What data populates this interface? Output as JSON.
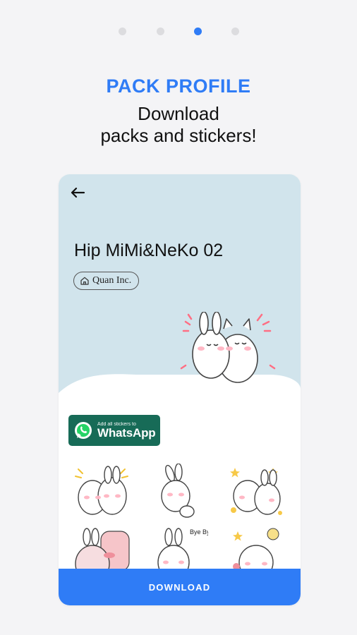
{
  "onboarding": {
    "pages": 4,
    "active_page": 3,
    "headline": "PACK PROFILE",
    "subline_1": "Download",
    "subline_2": "packs and stickers!"
  },
  "pack": {
    "title": "Hip MiMi&NeKo 02",
    "author": "Quan Inc.",
    "whatsapp_small": "Add all stickers to",
    "whatsapp_big": "WhatsApp",
    "download_label": "DOWNLOAD",
    "stickers": [
      {
        "name": "sticker-bunny-cat-blush"
      },
      {
        "name": "sticker-bunny-leaning"
      },
      {
        "name": "sticker-bunny-cat-party"
      },
      {
        "name": "sticker-pink-bunny"
      },
      {
        "name": "sticker-bunny-bye-bye",
        "text": "Bye Bye"
      },
      {
        "name": "sticker-cat-stars"
      }
    ]
  },
  "colors": {
    "accent": "#2f7cf6",
    "header_bg": "#d1e4ec",
    "whatsapp_green": "#176b57"
  },
  "icons": [
    "back-arrow-icon",
    "home-icon",
    "whatsapp-icon"
  ]
}
